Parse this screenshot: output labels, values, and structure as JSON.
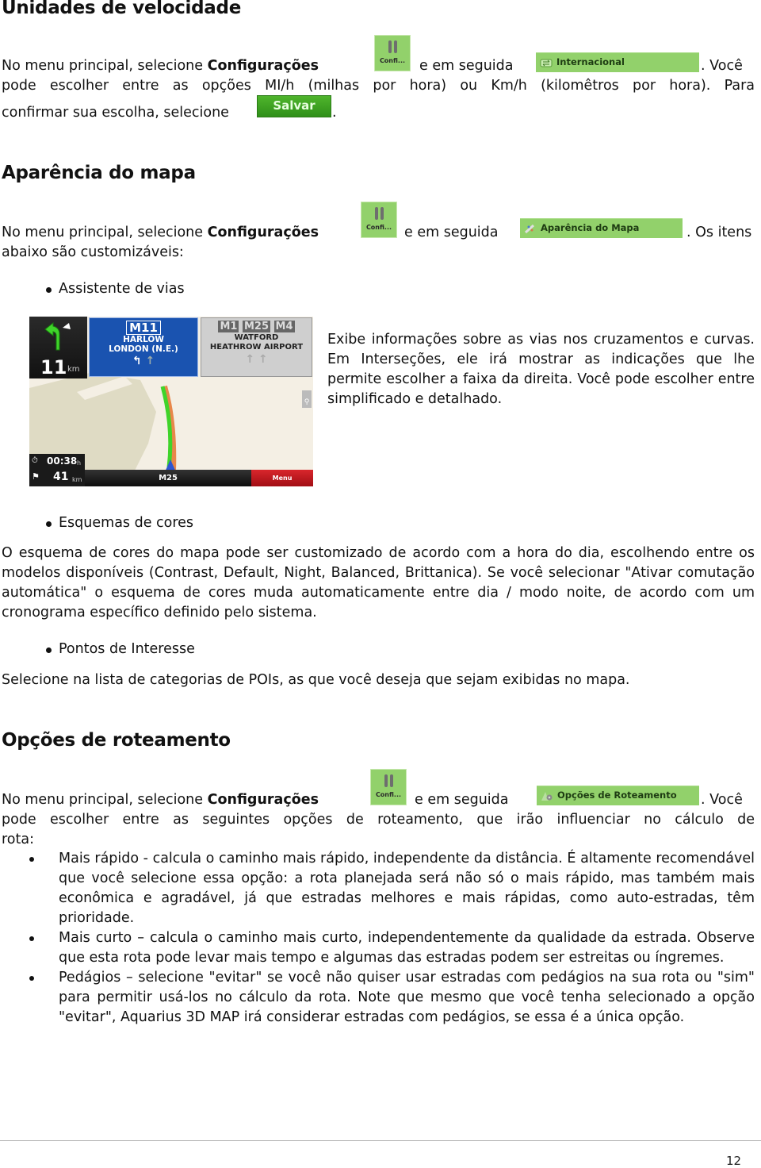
{
  "sections": {
    "speed_units": {
      "title": "Unidades de velocidade",
      "p1_a": "No menu principal, selecione",
      "p1_bold": "Configurações",
      "p1_b": "e em seguida",
      "p1_c": ". Você",
      "p2": "pode escolher entre as opções MI/h (milhas por hora) ou Km/h (kilomêtros por hora). Para",
      "p3_a": "confirmar sua escolha, selecione",
      "p3_b": ".",
      "config_button_label": "Confi...",
      "menu_item_label": "Internacional",
      "save_button_label": "Salvar"
    },
    "map_appearance": {
      "title": "Aparência do mapa",
      "p1_a": "No menu principal, selecione",
      "p1_bold": "Configurações",
      "p1_b": "e em seguida",
      "p1_c": ". Os itens",
      "p2": "abaixo são customizáveis:",
      "config_button_label": "Confi...",
      "menu_item_label": "Aparência do Mapa",
      "items": [
        {
          "label": "Assistente de vias",
          "description": "Exibe informações sobre as vias nos cruzamentos e curvas. Em Interseções, ele irá mostrar as indicações que lhe permite escolher a faixa da direita. Você pode escolher entre simplificado e detalhado."
        },
        {
          "label": "Esquemas de cores",
          "description": "O esquema de cores do mapa pode ser customizado de acordo com a hora do dia, escolhendo entre os modelos disponíveis (Contrast, Default, Night, Balanced, Brittanica). Se você selecionar \"Ativar comutação automática\" o esquema de cores muda automaticamente entre dia / modo noite, de acordo com um cronograma específico definido pelo sistema."
        },
        {
          "label": "Pontos de Interesse",
          "description": "Selecione na lista de categorias de POIs, as que você deseja que sejam exibidas no mapa."
        }
      ]
    },
    "routing_options": {
      "title": "Opções de roteamento",
      "p1_a": "No menu principal, selecione",
      "p1_bold": "Configurações",
      "p1_b": "e em seguida",
      "p1_c": ". Você",
      "p2": "pode escolher entre as seguintes opções de roteamento, que irão influenciar no cálculo de",
      "p3": "rota:",
      "config_button_label": "Confi...",
      "menu_item_label": "Opções de Roteamento",
      "options": [
        "Mais rápido - calcula o caminho mais rápido, independente da distância. É altamente recomendável que você selecione essa opção: a rota planejada será não só o mais rápido, mas também mais econômica e agradável, já que estradas melhores e mais rápidas, como auto-estradas, têm prioridade.",
        "Mais curto – calcula o caminho mais curto, independentemente da qualidade da estrada. Observe que esta rota pode levar mais tempo e algumas das estradas podem ser estreitas ou íngremes.",
        "Pedágios – selecione \"evitar\" se você não quiser usar estradas com pedágios na sua rota ou \"sim\" para permitir usá-los no cálculo da rota. Note que mesmo que você tenha selecionado a opção \"evitar\", Aquarius 3D MAP irá considerar estradas com pedágios, se essa é a única opção."
      ]
    }
  },
  "nav_screenshot": {
    "next_turn_distance": "11",
    "next_turn_unit": "km",
    "sign_blue": {
      "road": "M11",
      "line1": "HARLOW",
      "line2": "LONDON (N.E.)"
    },
    "sign_grey": {
      "roads": [
        "M1",
        "M25",
        "M4"
      ],
      "line1": "WATFORD",
      "line2": "HEATHROW AIRPORT"
    },
    "eta": "00:38",
    "eta_unit": "h",
    "remaining_distance": "41",
    "remaining_unit": "km",
    "current_road": "M25",
    "menu_label": "Menu",
    "colors": {
      "route_green": "#3fd42a",
      "route_orange": "#e8874a",
      "menu_red": "#c4161c",
      "sign_blue": "#1a53b0"
    }
  },
  "footer": {
    "page_number": "12"
  },
  "colors": {
    "button_green": "#92d16b",
    "save_green": "#3a9f21"
  }
}
